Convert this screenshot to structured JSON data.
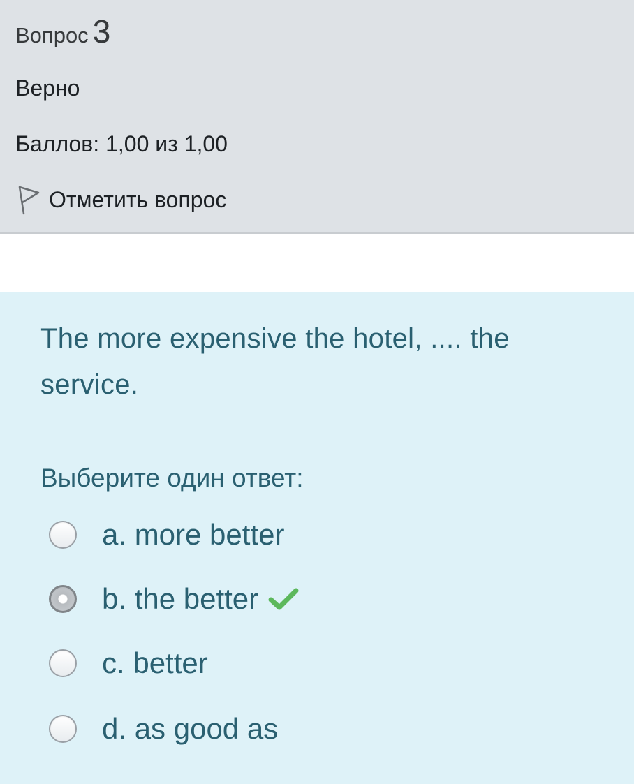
{
  "info": {
    "question_word": "Вопрос",
    "question_number": "3",
    "state": "Верно",
    "grade": "Баллов: 1,00 из 1,00",
    "flag_label": "Отметить вопрос",
    "flag_icon": "flag-icon"
  },
  "question": {
    "text": "The more expensive the hotel, .... the service.",
    "prompt": "Выберите один ответ:",
    "options": [
      {
        "label": "a. more better",
        "selected": false,
        "correct": false
      },
      {
        "label": "b. the better",
        "selected": true,
        "correct": true
      },
      {
        "label": "c. better",
        "selected": false,
        "correct": false
      },
      {
        "label": "d. as good as",
        "selected": false,
        "correct": false
      }
    ],
    "correct_icon": "check-icon"
  },
  "colors": {
    "info_bg": "#dee2e6",
    "content_bg": "#def2f8",
    "text_teal": "#2a6071",
    "check_green": "#5cb85c"
  }
}
